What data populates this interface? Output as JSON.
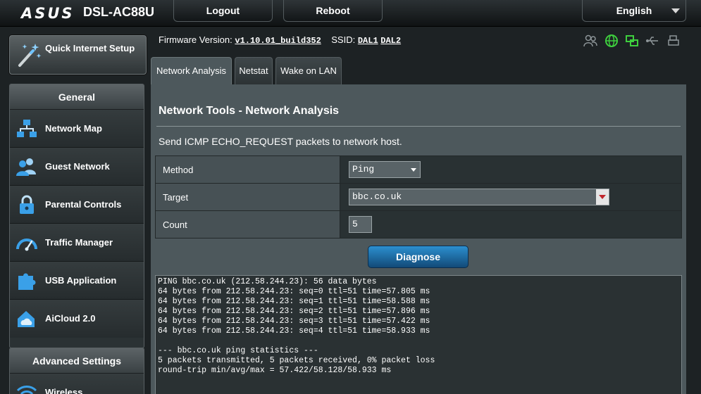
{
  "header": {
    "logo": "ASUS",
    "model": "DSL-AC88U",
    "logout_label": "Logout",
    "reboot_label": "Reboot",
    "language": "English"
  },
  "sidebar": {
    "quick_setup": "Quick Internet Setup",
    "general_heading": "General",
    "items": [
      {
        "label": "Network Map",
        "icon": "network-map-icon"
      },
      {
        "label": "Guest Network",
        "icon": "guest-network-icon"
      },
      {
        "label": "Parental Controls",
        "icon": "lock-icon"
      },
      {
        "label": "Traffic Manager",
        "icon": "gauge-icon"
      },
      {
        "label": "USB Application",
        "icon": "puzzle-icon"
      },
      {
        "label": "AiCloud 2.0",
        "icon": "cloud-house-icon"
      }
    ],
    "advanced_heading": "Advanced Settings",
    "advanced_items": [
      {
        "label": "Wireless",
        "icon": "wifi-icon"
      }
    ]
  },
  "firmware": {
    "label": "Firmware Version:",
    "version": "v1.10.01_build352",
    "ssid_label": "SSID:",
    "ssid1": "DAL1",
    "ssid2": "DAL2"
  },
  "status_icons": [
    "users-icon",
    "globe-icon",
    "network-icon",
    "usb-icon",
    "printer-icon"
  ],
  "colors": {
    "accent_green": "#3ecf3e",
    "diagnose_blue": "#1f6fa8"
  },
  "tabs": [
    {
      "label": "Network Analysis",
      "active": true
    },
    {
      "label": "Netstat",
      "active": false
    },
    {
      "label": "Wake on LAN",
      "active": false
    }
  ],
  "main": {
    "title": "Network Tools - Network Analysis",
    "description": "Send ICMP ECHO_REQUEST packets to network host.",
    "method_label": "Method",
    "method_value": "Ping",
    "target_label": "Target",
    "target_value": "bbc.co.uk",
    "count_label": "Count",
    "count_value": "5",
    "diagnose_label": "Diagnose",
    "output": "PING bbc.co.uk (212.58.244.23): 56 data bytes\n64 bytes from 212.58.244.23: seq=0 ttl=51 time=57.805 ms\n64 bytes from 212.58.244.23: seq=1 ttl=51 time=58.588 ms\n64 bytes from 212.58.244.23: seq=2 ttl=51 time=57.896 ms\n64 bytes from 212.58.244.23: seq=3 ttl=51 time=57.422 ms\n64 bytes from 212.58.244.23: seq=4 ttl=51 time=58.933 ms\n\n--- bbc.co.uk ping statistics ---\n5 packets transmitted, 5 packets received, 0% packet loss\nround-trip min/avg/max = 57.422/58.128/58.933 ms"
  }
}
